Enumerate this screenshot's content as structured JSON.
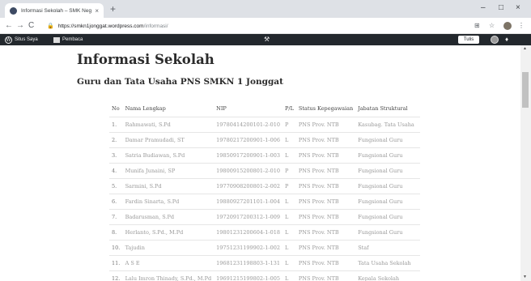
{
  "browser": {
    "tab_title": "Informasi Sekolah – SMK Negeri",
    "tab_close": "×",
    "new_tab": "+",
    "window_controls": [
      "–",
      "□",
      "×"
    ],
    "nav": {
      "back": "←",
      "forward": "→",
      "reload": "C"
    },
    "url": {
      "host": "https://smkn1jonggat.wordpress.com",
      "path": "/informasi/"
    },
    "toolbar_icons": [
      "tab-search-icon",
      "star-icon",
      "profile-avatar-icon",
      "menu-icon"
    ]
  },
  "adminbar": {
    "site_label": "Situs Saya",
    "reader_label": "Pembaca",
    "center_icon": "⚒",
    "write_label": "Tulis",
    "notification_icon": "bell-icon"
  },
  "page": {
    "title": "Informasi Sekolah",
    "subtitle": "Guru dan Tata Usaha PNS SMKN 1 Jonggat",
    "table": {
      "headers": [
        "No",
        "Nama Lengkap",
        "NIP",
        "P/L",
        "Status Kepegawaian",
        "Jabatan Struktural"
      ],
      "rows": [
        [
          "1.",
          "Rahmawati, S.Pd",
          "19780414200101-2-010",
          "P",
          "PNS Prov. NTB",
          "Kasubag. Tata Usaha"
        ],
        [
          "2.",
          "Damar Pramudadi, ST",
          "19780217200901-1-006",
          "L",
          "PNS Prov. NTB",
          "Fungsional Guru"
        ],
        [
          "3.",
          "Satria Budiawan, S.Pd",
          "19850917200901-1-003",
          "L",
          "PNS Prov. NTB",
          "Fungsional Guru"
        ],
        [
          "4.",
          "Munifa Junaini, SP",
          "19800915200801-2-010",
          "P",
          "PNS Prov. NTB",
          "Fungsional Guru"
        ],
        [
          "5.",
          "Sarmini, S.Pd",
          "19770908200801-2-002",
          "P",
          "PNS Prov. NTB",
          "Fungsional Guru"
        ],
        [
          "6.",
          "Fardin Sinarta, S.Pd",
          "19880927201101-1-004",
          "L",
          "PNS Prov. NTB",
          "Fungsional Guru"
        ],
        [
          "7.",
          "Badarusman, S.Pd",
          "19720917200312-1-009",
          "L",
          "PNS Prov. NTB",
          "Fungsional Guru"
        ],
        [
          "8.",
          "Herlanto, S.Pd., M.Pd",
          "19801231200604-1-018",
          "L",
          "PNS Prov. NTB",
          "Fungsional Guru"
        ],
        [
          "10.",
          "Tajudin",
          "19751231199902-1-002",
          "L",
          "PNS Prov. NTB",
          "Staf"
        ],
        [
          "11.",
          "A S E",
          "19681231198803-1-131",
          "L",
          "PNS Prov. NTB",
          "Tata Usaha Sekolah"
        ],
        [
          "12.",
          "Lalu Imron Thinady, S.Pd., M.Pd",
          "19691215199802-1-005",
          "L",
          "PNS Prov. NTB",
          "Kepala Sekolah"
        ]
      ]
    }
  }
}
